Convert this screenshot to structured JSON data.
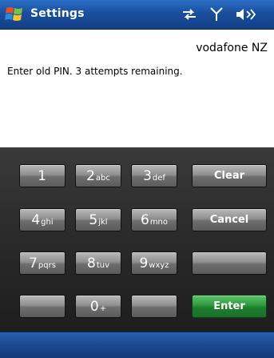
{
  "titlebar": {
    "title": "Settings",
    "icons": [
      "windows-start-icon",
      "connectivity-icon",
      "signal-icon",
      "volume-icon"
    ]
  },
  "operator": "vodafone NZ",
  "prompt": "Enter old PIN.  3 attempts remaining.",
  "keypad": {
    "keys": [
      {
        "digit": "1",
        "letters": ""
      },
      {
        "digit": "2",
        "letters": "abc"
      },
      {
        "digit": "3",
        "letters": "def"
      },
      {
        "digit": "4",
        "letters": "ghi"
      },
      {
        "digit": "5",
        "letters": "jkl"
      },
      {
        "digit": "6",
        "letters": "mno"
      },
      {
        "digit": "7",
        "letters": "pqrs"
      },
      {
        "digit": "8",
        "letters": "tuv"
      },
      {
        "digit": "9",
        "letters": "wxyz"
      },
      {
        "digit": "0",
        "letters": "+"
      }
    ],
    "clear_label": "Clear",
    "cancel_label": "Cancel",
    "enter_label": "Enter"
  },
  "colors": {
    "titlebar": "#1a4f9e",
    "keypad_background": "#2a2a2a",
    "key": "#8f8f8f",
    "enter_key": "#2f9a3e"
  }
}
